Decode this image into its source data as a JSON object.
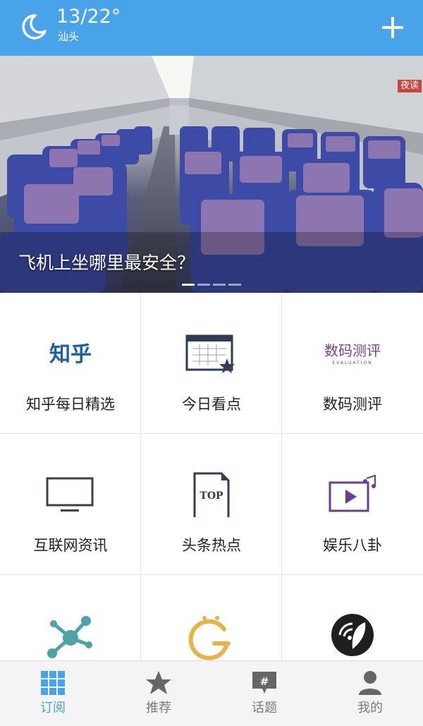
{
  "colors": {
    "primary": "#48a3e8",
    "night_badge": "#c9433f",
    "nav_inactive": "#7a7a7a"
  },
  "header": {
    "temperature": "13/22°",
    "city": "汕头",
    "weather_icon": "crescent-moon-icon",
    "add_icon": "plus-icon"
  },
  "banner": {
    "night_mode_label": "夜读",
    "title": "飞机上坐哪里最安全？",
    "page_count": 4,
    "active_page": 1
  },
  "grid": {
    "items": [
      {
        "label": "知乎每日精选",
        "icon": "zhihu-logo",
        "logo_text": "知乎"
      },
      {
        "label": "今日看点",
        "icon": "calendar-star-icon"
      },
      {
        "label": "数码测评",
        "icon": "shuma-ceping-logo",
        "logo_text": "数码测评",
        "logo_subtext": "EVALUATION"
      },
      {
        "label": "互联网资讯",
        "icon": "monitor-icon"
      },
      {
        "label": "头条热点",
        "icon": "top-document-icon",
        "icon_text": "TOP"
      },
      {
        "label": "娱乐八卦",
        "icon": "video-music-icon"
      },
      {
        "label": "",
        "icon": "network-nodes-icon"
      },
      {
        "label": "",
        "icon": "smiley-g-icon"
      },
      {
        "label": "",
        "icon": "wifi-leaf-icon"
      }
    ]
  },
  "bottom_nav": {
    "items": [
      {
        "label": "订阅",
        "icon": "grid-icon",
        "active": true
      },
      {
        "label": "推荐",
        "icon": "star-icon",
        "active": false
      },
      {
        "label": "话题",
        "icon": "hashtag-bubble-icon",
        "active": false
      },
      {
        "label": "我的",
        "icon": "person-icon",
        "active": false
      }
    ]
  }
}
